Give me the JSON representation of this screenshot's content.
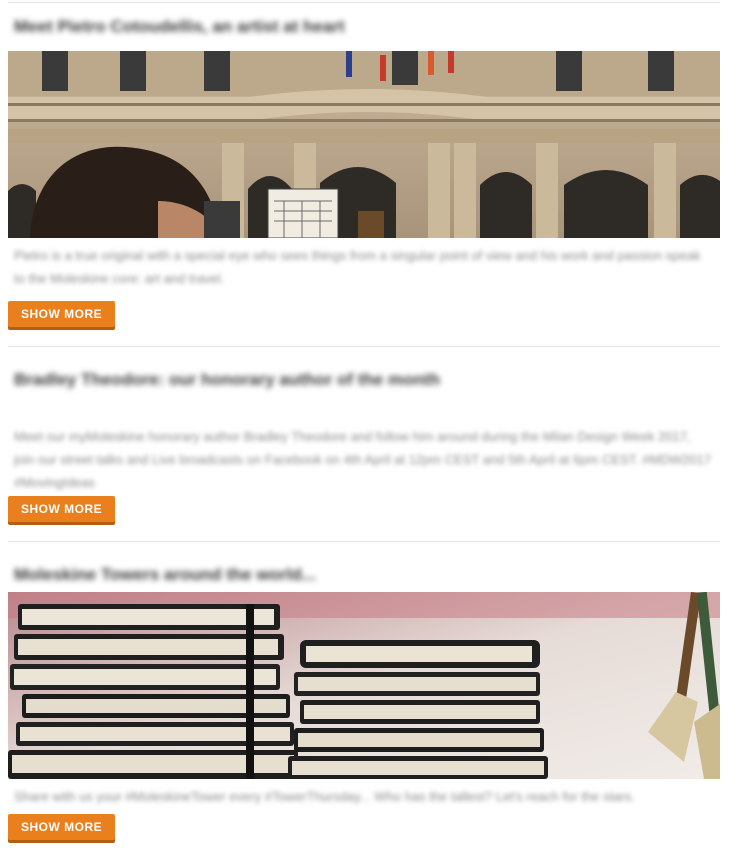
{
  "posts": [
    {
      "title": "Meet Pietro Cotoudellis, an artist at heart",
      "excerpt": "Pietro is a true original with a special eye who sees things from a singular point of view and his work and passion speak to the Moleskine core: art and travel.",
      "button_label": "SHOW MORE",
      "image": "palazzo-facade-sketch-photo"
    },
    {
      "title": "Bradley Theodore: our honorary author of the month",
      "excerpt": "Meet our myMoleskine honorary author Bradley Theodore and follow him around during the Milan Design Week 2017, join our street talks and Live broadcasts on Facebook on 4th April at 12pm CEST and 5th April at 6pm CEST. #MDW2017 #MovingIdeas",
      "button_label": "SHOW MORE"
    },
    {
      "title": "Moleskine Towers around the world...",
      "excerpt": "Share with us your #MoleskineTower every #TowerThursday... Who has the tallest? Let's reach for the stars.",
      "button_label": "SHOW MORE",
      "image": "notebook-stacks-photo"
    }
  ],
  "colors": {
    "button": "#ea7f1d",
    "button_shadow": "#b65e10",
    "divider": "#e6e6e6"
  }
}
